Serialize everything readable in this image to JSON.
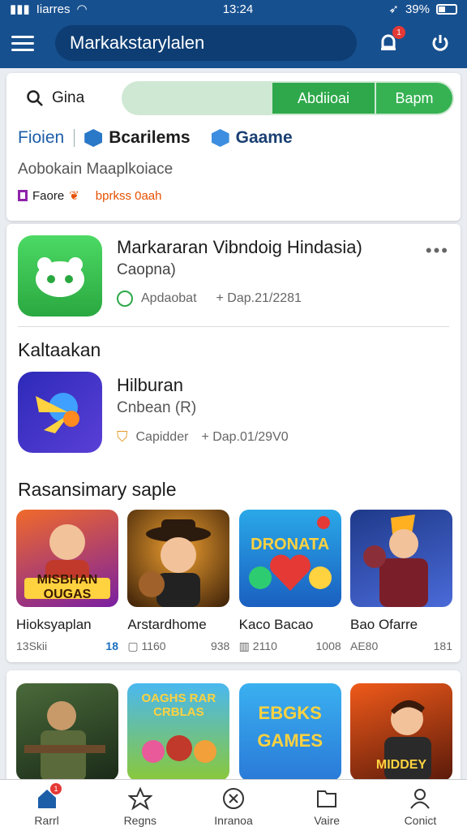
{
  "status_bar": {
    "carrier": "Iiarres",
    "time": "13:24",
    "battery": "39%"
  },
  "header": {
    "search_text": "Markakstarylalen",
    "notif_count": "1"
  },
  "filter": {
    "search_value": "Gina",
    "toggle_a": "Abdiioai",
    "toggle_b": "Bapm",
    "tab1": "Fioien",
    "tab2": "Bcarilems",
    "tab3": "Gaame",
    "subtitle": "Aobokain Maaplkoiace",
    "chip1": "Faore",
    "chip2": "bprkss 0aah"
  },
  "featured": {
    "title": "Markararan Vibndoig Hindasia)",
    "subtitle": "Caopna)",
    "meta1": "Apdaobat",
    "meta2": "+ Dap.21/2281"
  },
  "section1": {
    "title": "Kaltaakan"
  },
  "app2": {
    "title": "Hilburan",
    "subtitle": "Cnbean (R)",
    "meta1": "Capidder",
    "meta2": "+ Dap.01/29V0"
  },
  "section2": {
    "title": "Rasansimary saple"
  },
  "games": [
    {
      "thumb_text": "MISBHAN OUGAS",
      "name": "Hioksyaplan",
      "stat1": "13Skii",
      "stat2": "18"
    },
    {
      "thumb_text": "",
      "name": "Arstardhome",
      "stat1": "1160",
      "stat2": "938"
    },
    {
      "thumb_text": "DRONATA",
      "name": "Kaco Bacao",
      "stat1": "2110",
      "stat2": "1008"
    },
    {
      "thumb_text": "",
      "name": "Bao Ofarre",
      "stat1": "AE80",
      "stat2": "181"
    }
  ],
  "games_row2": [
    {
      "thumb_text": ""
    },
    {
      "thumb_text": "OAGHS RAR CRBLAS"
    },
    {
      "thumb_text": "EBGKS GAMES"
    },
    {
      "thumb_text": "MIDDEY"
    }
  ],
  "nav": {
    "home": "Rarrl",
    "star": "Regns",
    "x": "Inranoa",
    "folder": "Vaire",
    "user": "Conict",
    "home_badge": "1"
  },
  "colors": {
    "header": "#17508f",
    "accent_green": "#2ea84a",
    "link_blue": "#1d5ea8"
  }
}
